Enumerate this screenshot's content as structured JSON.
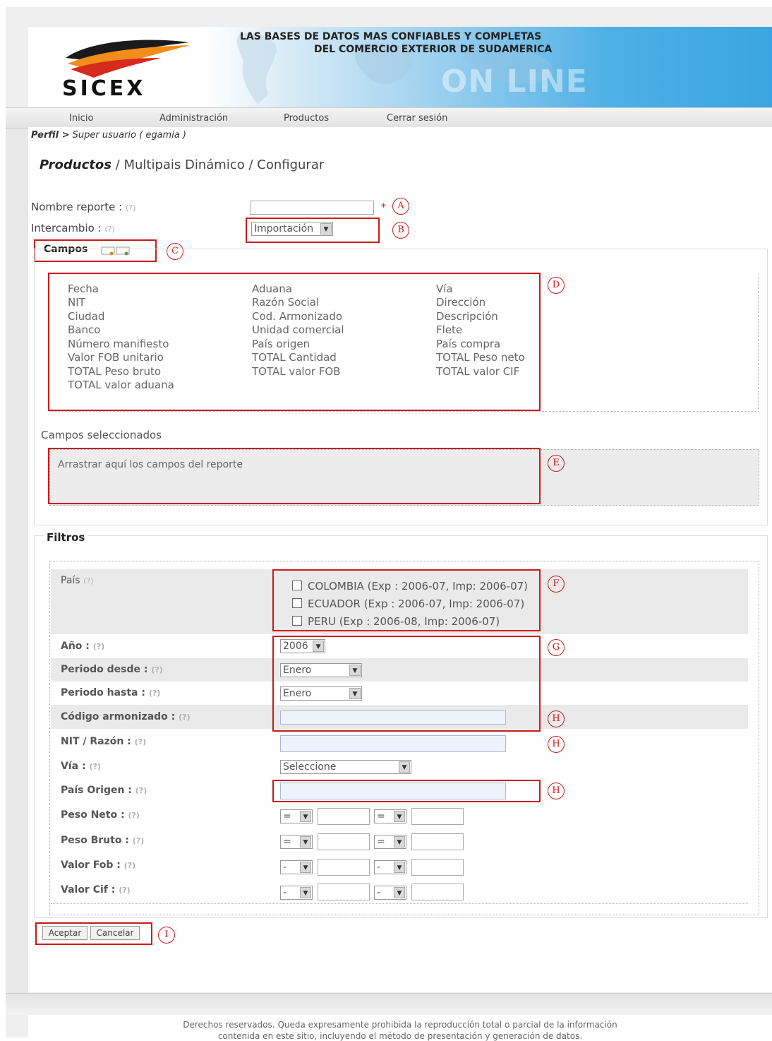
{
  "header": {
    "logo_text": "SICEX",
    "tagline_1": "LAS BASES DE DATOS MAS CONFIABLES Y COMPLETAS",
    "tagline_2": "DEL COMERCIO EXTERIOR DE SUDAMERICA",
    "online": "ON LINE"
  },
  "nav": [
    "Inicio",
    "Administración",
    "Productos",
    "Cerrar sesión"
  ],
  "breadcrumb": {
    "profile": "Perfil >",
    "user": "Super usuario ( egamia )"
  },
  "page_title": {
    "main": "Productos",
    "rest": " / Multipais Dinámico / Configurar"
  },
  "form": {
    "report_name_label": "Nombre reporte :",
    "exchange_label": "Intercambio :",
    "help": "(?)",
    "required_mark": "*",
    "exchange_value": "Importación"
  },
  "campos": {
    "title": "Campos",
    "columns": [
      [
        "Fecha",
        "NIT",
        "Ciudad",
        "Banco",
        "Número manifiesto",
        "Valor FOB unitario",
        "TOTAL Peso bruto",
        "TOTAL valor aduana"
      ],
      [
        "Aduana",
        "Razón Social",
        "Cod. Armonizado",
        "Unidad comercial",
        "País origen",
        "TOTAL Cantidad",
        "TOTAL valor FOB"
      ],
      [
        "Vía",
        "Dirección",
        "Descripción",
        "Flete",
        "País compra",
        "TOTAL Peso neto",
        "TOTAL valor CIF"
      ]
    ],
    "selected_title": "Campos seleccionados",
    "drop_hint": "Arrastrar aquí los campos del reporte"
  },
  "filtros": {
    "title": "Filtros",
    "pais_label": "País",
    "countries": [
      "COLOMBIA (Exp : 2006-07, Imp: 2006-07)",
      "ECUADOR (Exp : 2006-07, Imp: 2006-07)",
      "PERU (Exp : 2006-08, Imp: 2006-07)"
    ],
    "anio_label": "Año :",
    "anio_value": "2006",
    "desde_label": "Periodo desde :",
    "desde_value": "Enero",
    "hasta_label": "Periodo hasta :",
    "hasta_value": "Enero",
    "codigo_label": "Código armonizado :",
    "nit_label": "NIT / Razón :",
    "via_label": "Vía :",
    "via_value": "Seleccione",
    "origen_label": "País Origen :",
    "peso_neto_label": "Peso Neto :",
    "peso_bruto_label": "Peso Bruto :",
    "fob_label": "Valor Fob :",
    "cif_label": "Valor Cif :",
    "op_eq": "=",
    "op_dash": "-"
  },
  "buttons": {
    "accept": "Aceptar",
    "cancel": "Cancelar"
  },
  "annotations": [
    "A",
    "B",
    "C",
    "D",
    "E",
    "F",
    "G",
    "H",
    "I"
  ],
  "footer": {
    "line1": "Derechos reservados. Queda expresamente prohibida la reproducción total o parcial de la información",
    "line2": "contenida en este sitio, incluyendo el método de presentación y generación de datos."
  },
  "colors": {
    "annotation_red": "#cc1a1a",
    "header_blue": "#3aa5e0",
    "logo_orange": "#f28c1a",
    "logo_red": "#d52b1e"
  }
}
